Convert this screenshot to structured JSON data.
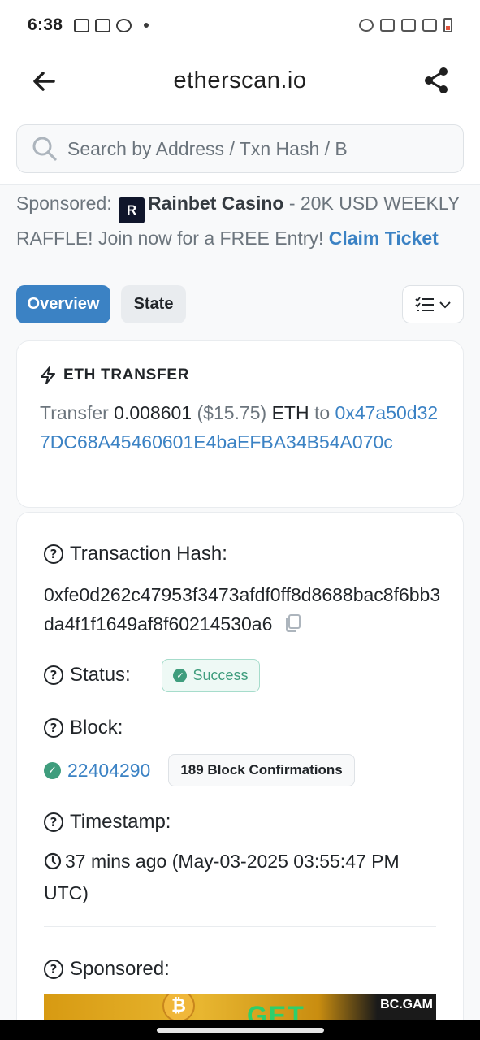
{
  "status_bar": {
    "time": "6:38"
  },
  "browser": {
    "host": "etherscan.io"
  },
  "search": {
    "placeholder": "Search by Address / Txn Hash / B"
  },
  "sponsored_top": {
    "prefix": "Sponsored:",
    "logo_text": "R",
    "brand": "Rainbet Casino",
    "text": " - 20K USD WEEKLY RAFFLE! Join now for a FREE Entry! ",
    "cta": "Claim Ticket"
  },
  "tabs": [
    {
      "label": "Overview"
    },
    {
      "label": "State"
    }
  ],
  "transfer": {
    "heading": "ETH TRANSFER",
    "word_transfer": "Transfer",
    "amount": "0.008601",
    "usd": "($15.75)",
    "unit": "ETH",
    "word_to": "to",
    "to_address": "0x47a50d327DC68A45460601E4baEFBA34B54A070c"
  },
  "details": {
    "hash_label": "Transaction Hash:",
    "hash_value": "0xfe0d262c47953f3473afdf0ff8d8688bac8f6bb3da4f1f1649af8f60214530a6",
    "status_label": "Status:",
    "status_value": "Success",
    "block_label": "Block:",
    "block_number": "22404290",
    "block_confirmations": "189 Block Confirmations",
    "timestamp_label": "Timestamp:",
    "timestamp_value": "37 mins ago (May-03-2025 03:55:47 PM UTC)",
    "sponsored_label": "Sponsored:"
  },
  "banner": {
    "brand": "BC.GAM",
    "coin": "₿",
    "text": "GET"
  },
  "colors": {
    "accent": "#3b82c4",
    "success": "#3f9d7d"
  }
}
